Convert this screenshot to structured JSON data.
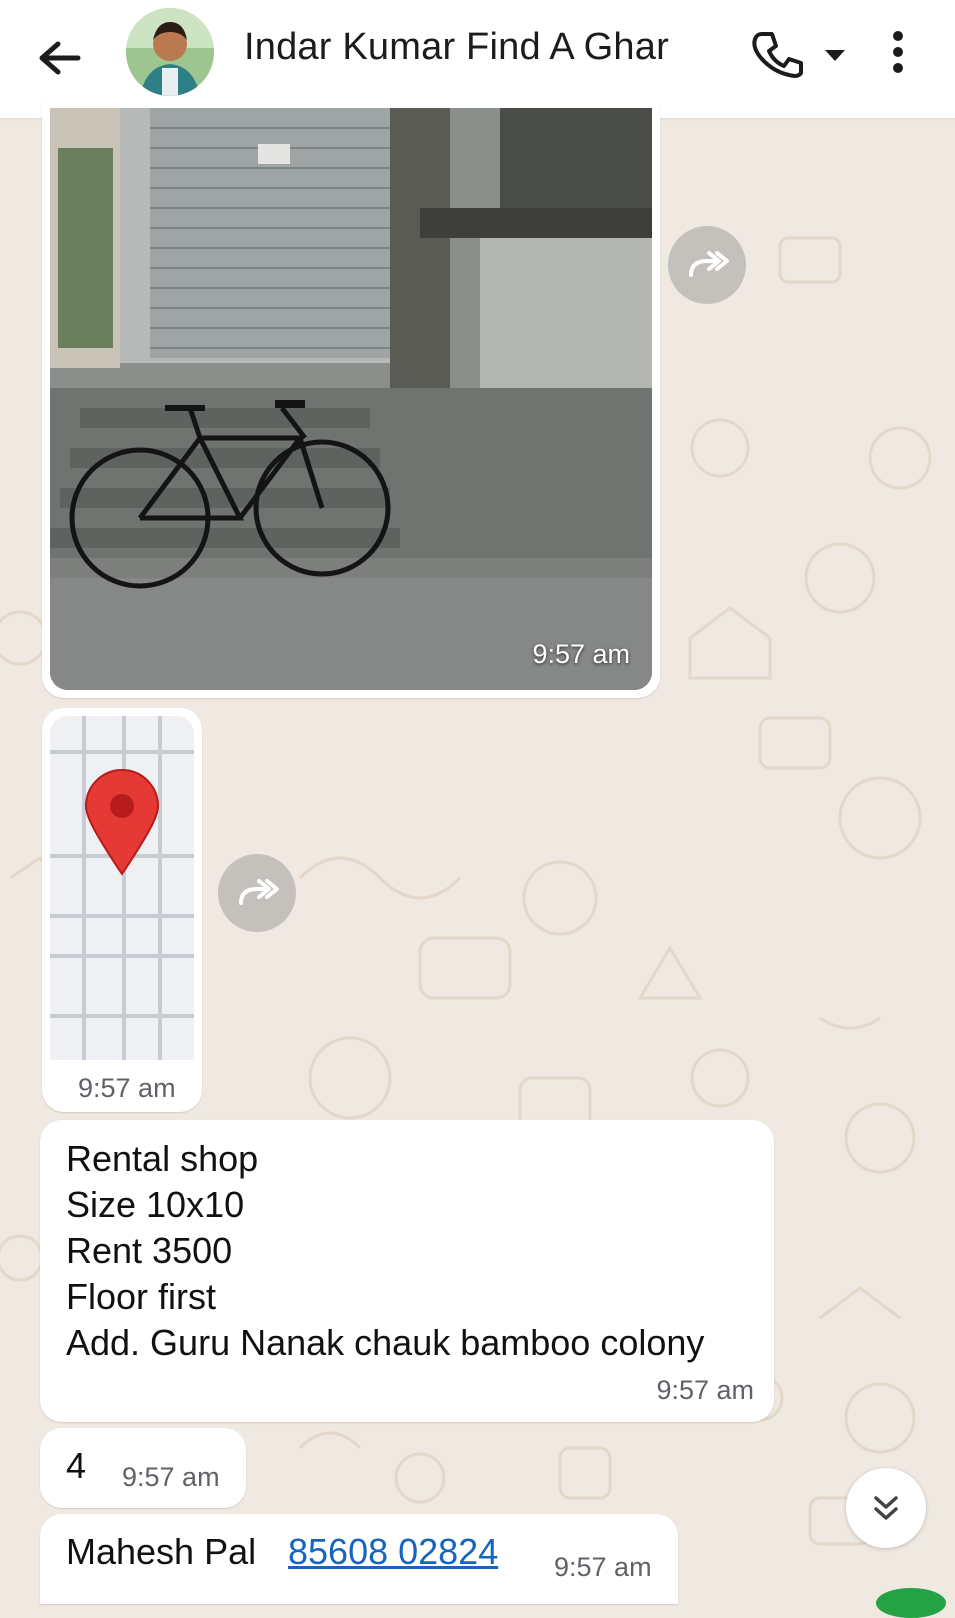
{
  "header": {
    "title": "Indar Kumar Find A Ghar"
  },
  "messages": {
    "photo": {
      "time": "9:57 am"
    },
    "location": {
      "time": "9:57 am"
    },
    "listing": {
      "lines": [
        "Rental shop",
        "Size 10x10",
        "Rent 3500",
        "Floor first",
        "Add. Guru Nanak chauk bamboo colony"
      ],
      "time": "9:57 am"
    },
    "number": {
      "text": "4",
      "time": "9:57 am"
    },
    "contact": {
      "name": "Mahesh Pal",
      "phone": "85608 02824",
      "time": "9:57 am"
    }
  },
  "colors": {
    "wallpaper": "#efe9e1",
    "bubble": "#ffffff",
    "link": "#1565c0",
    "pin": "#e53935"
  }
}
